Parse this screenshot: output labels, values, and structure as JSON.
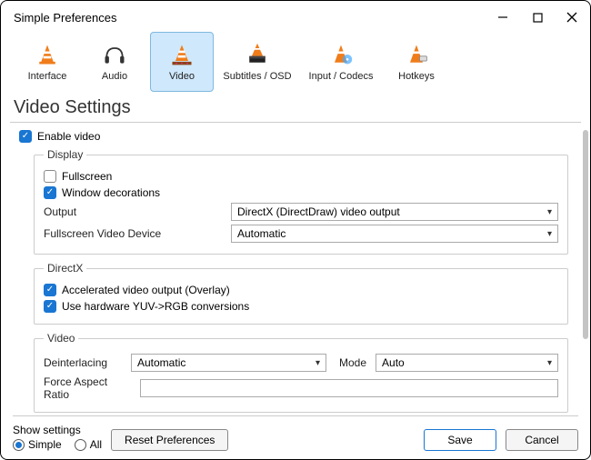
{
  "window": {
    "title": "Simple Preferences"
  },
  "tabs": [
    {
      "label": "Interface"
    },
    {
      "label": "Audio"
    },
    {
      "label": "Video"
    },
    {
      "label": "Subtitles / OSD"
    },
    {
      "label": "Input / Codecs"
    },
    {
      "label": "Hotkeys"
    }
  ],
  "section_title": "Video Settings",
  "enable_video": {
    "label": "Enable video",
    "checked": true
  },
  "display": {
    "legend": "Display",
    "fullscreen": {
      "label": "Fullscreen",
      "checked": false
    },
    "window_decorations": {
      "label": "Window decorations",
      "checked": true
    },
    "output": {
      "label": "Output",
      "value": "DirectX (DirectDraw) video output"
    },
    "fullscreen_device": {
      "label": "Fullscreen Video Device",
      "value": "Automatic"
    }
  },
  "directx": {
    "legend": "DirectX",
    "accelerated": {
      "label": "Accelerated video output (Overlay)",
      "checked": true
    },
    "yuv_rgb": {
      "label": "Use hardware YUV->RGB conversions",
      "checked": true
    }
  },
  "video": {
    "legend": "Video",
    "deinterlacing": {
      "label": "Deinterlacing",
      "value": "Automatic"
    },
    "mode": {
      "label": "Mode",
      "value": "Auto"
    },
    "force_aspect": {
      "label": "Force Aspect Ratio",
      "value": ""
    }
  },
  "footer": {
    "show_settings": "Show settings",
    "simple": "Simple",
    "all": "All",
    "reset": "Reset Preferences",
    "save": "Save",
    "cancel": "Cancel"
  }
}
